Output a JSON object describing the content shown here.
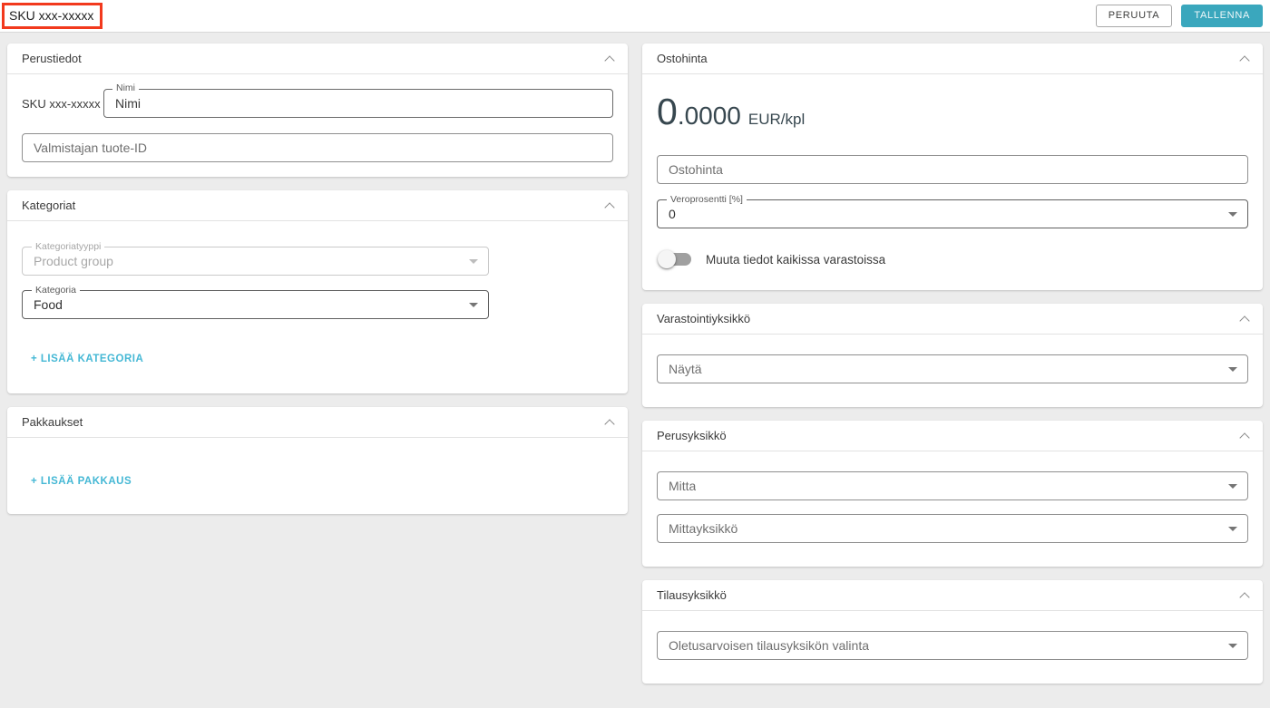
{
  "colors": {
    "accent_teal": "#3aa7bd",
    "link_teal": "#45b8d5",
    "highlight_red": "#f2391d",
    "price_text": "#37474f",
    "page_background": "#ececec"
  },
  "topbar": {
    "sku_label": "SKU xxx-xxxxx",
    "cancel_label": "PERUUTA",
    "save_label": "TALLENNA"
  },
  "left": {
    "perustiedot": {
      "title": "Perustiedot",
      "sku_text": "SKU xxx-xxxxx",
      "nimi_label": "Nimi",
      "nimi_value": "Nimi",
      "manufacturer_placeholder": "Valmistajan tuote-ID"
    },
    "kategoriat": {
      "title": "Kategoriat",
      "type_label": "Kategoriatyyppi",
      "type_value": "Product group",
      "category_label": "Kategoria",
      "category_value": "Food",
      "add_link": "+ LISÄÄ KATEGORIA"
    },
    "pakkaukset": {
      "title": "Pakkaukset",
      "add_link": "+ LISÄÄ PAKKAUS"
    }
  },
  "right": {
    "ostohinta": {
      "title": "Ostohinta",
      "price_integer": "0",
      "price_decimals": ".0000",
      "price_unit": "EUR/kpl",
      "price_placeholder": "Ostohinta",
      "vat_label": "Veroprosentti [%]",
      "vat_value": "0",
      "toggle_label": "Muuta tiedot kaikissa varastoissa"
    },
    "varastointiyksikko": {
      "title": "Varastointiyksikkö",
      "select_value": "Näytä"
    },
    "perusyksikko": {
      "title": "Perusyksikkö",
      "mitta_value": "Mitta",
      "mittayksikko_value": "Mittayksikkö"
    },
    "tilausyksikko": {
      "title": "Tilausyksikkö",
      "select_value": "Oletusarvoisen tilausyksikön valinta"
    }
  }
}
